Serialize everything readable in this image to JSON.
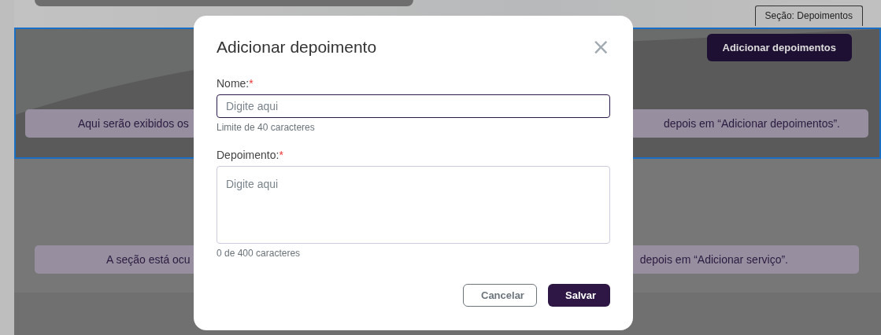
{
  "section_tag": "Seção: Depoimentos",
  "selected_section": {
    "add_button": "Adicionar depoimentos",
    "notice_parts": [
      "Aqui serão exibidos os",
      "depois em “Adicionar depoimentos”."
    ]
  },
  "hidden_section": {
    "notice_parts": [
      "A seção está ocu",
      "depois em “Adicionar serviço”."
    ]
  },
  "dialog": {
    "title": "Adicionar depoimento",
    "close": "×",
    "fields": [
      {
        "kind": "input",
        "label": "Nome:",
        "required_mark": "*",
        "placeholder": "Digite aqui",
        "focused": true,
        "hint": "Limite de 40 caracteres"
      },
      {
        "kind": "textarea",
        "label": "Depoimento:",
        "required_mark": "*",
        "placeholder": "Digite aqui",
        "focused": false,
        "hint": "0 de 400 caracteres"
      }
    ],
    "buttons": [
      {
        "kind": "secondary",
        "label": "Cancelar"
      },
      {
        "kind": "primary",
        "label": "Salvar"
      }
    ]
  }
}
